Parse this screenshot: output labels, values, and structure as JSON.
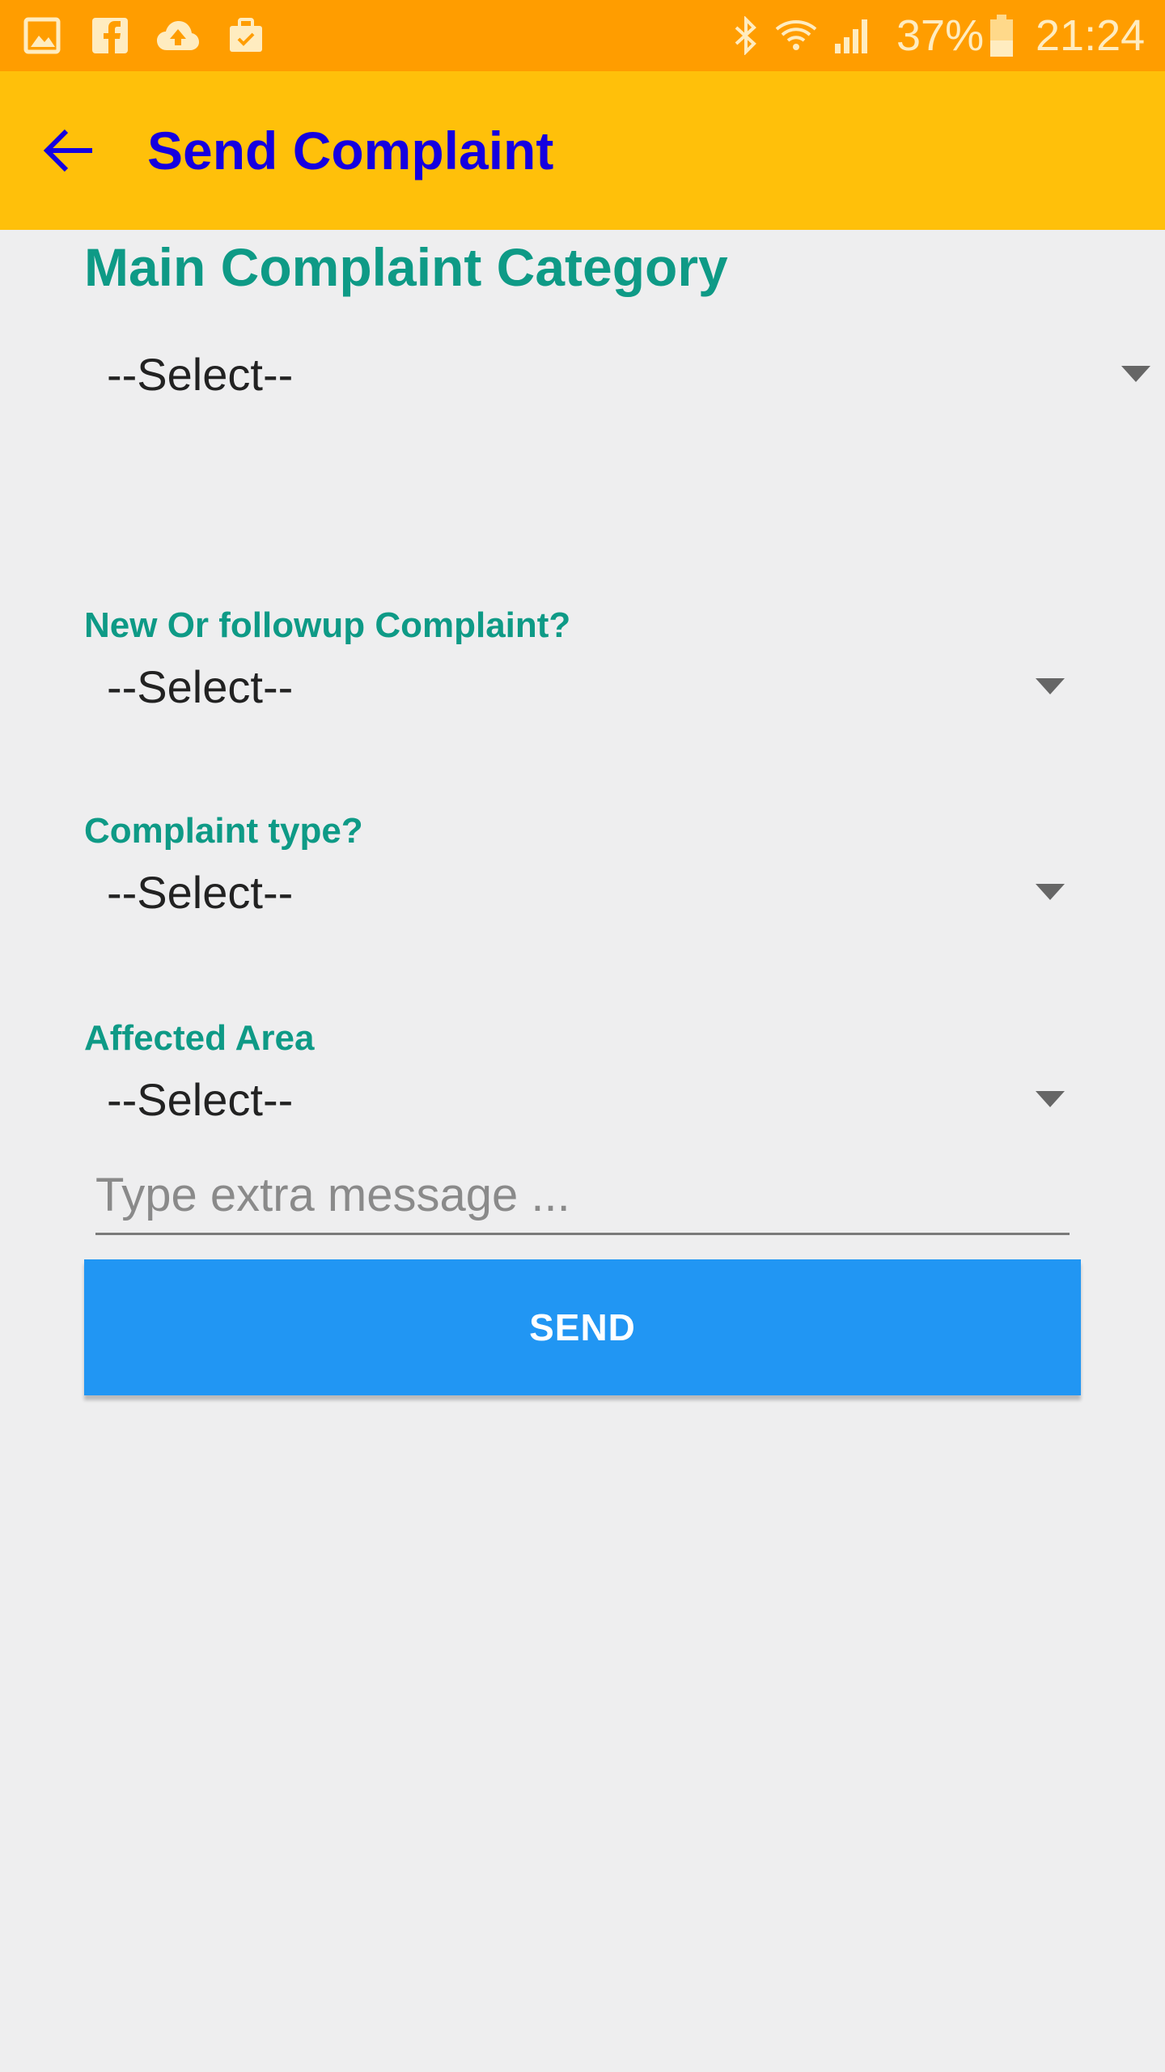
{
  "status_bar": {
    "left_icons": [
      "gallery-icon",
      "facebook-icon",
      "cloud-upload-icon",
      "briefcase-icon"
    ],
    "right_icons": [
      "bluetooth-icon",
      "wifi-icon",
      "signal-icon",
      "battery-icon"
    ],
    "battery_percent": "37%",
    "time": "21:24"
  },
  "app_bar": {
    "back_icon": "arrow-back-icon",
    "title": "Send Complaint",
    "background_color": "#ffc00a",
    "title_color": "#1500e0"
  },
  "form": {
    "main_category": {
      "heading": "Main Complaint Category",
      "selected": "--Select--"
    },
    "new_or_followup": {
      "label": "New Or followup Complaint?",
      "selected": "--Select--"
    },
    "complaint_type": {
      "label": "Complaint type?",
      "selected": "--Select--"
    },
    "affected_area": {
      "label": "Affected Area",
      "selected": "--Select--"
    },
    "message": {
      "placeholder": "Type extra message ...",
      "value": ""
    },
    "send_label": "SEND",
    "label_color": "#0e9a86",
    "button_color": "#2196f3"
  }
}
